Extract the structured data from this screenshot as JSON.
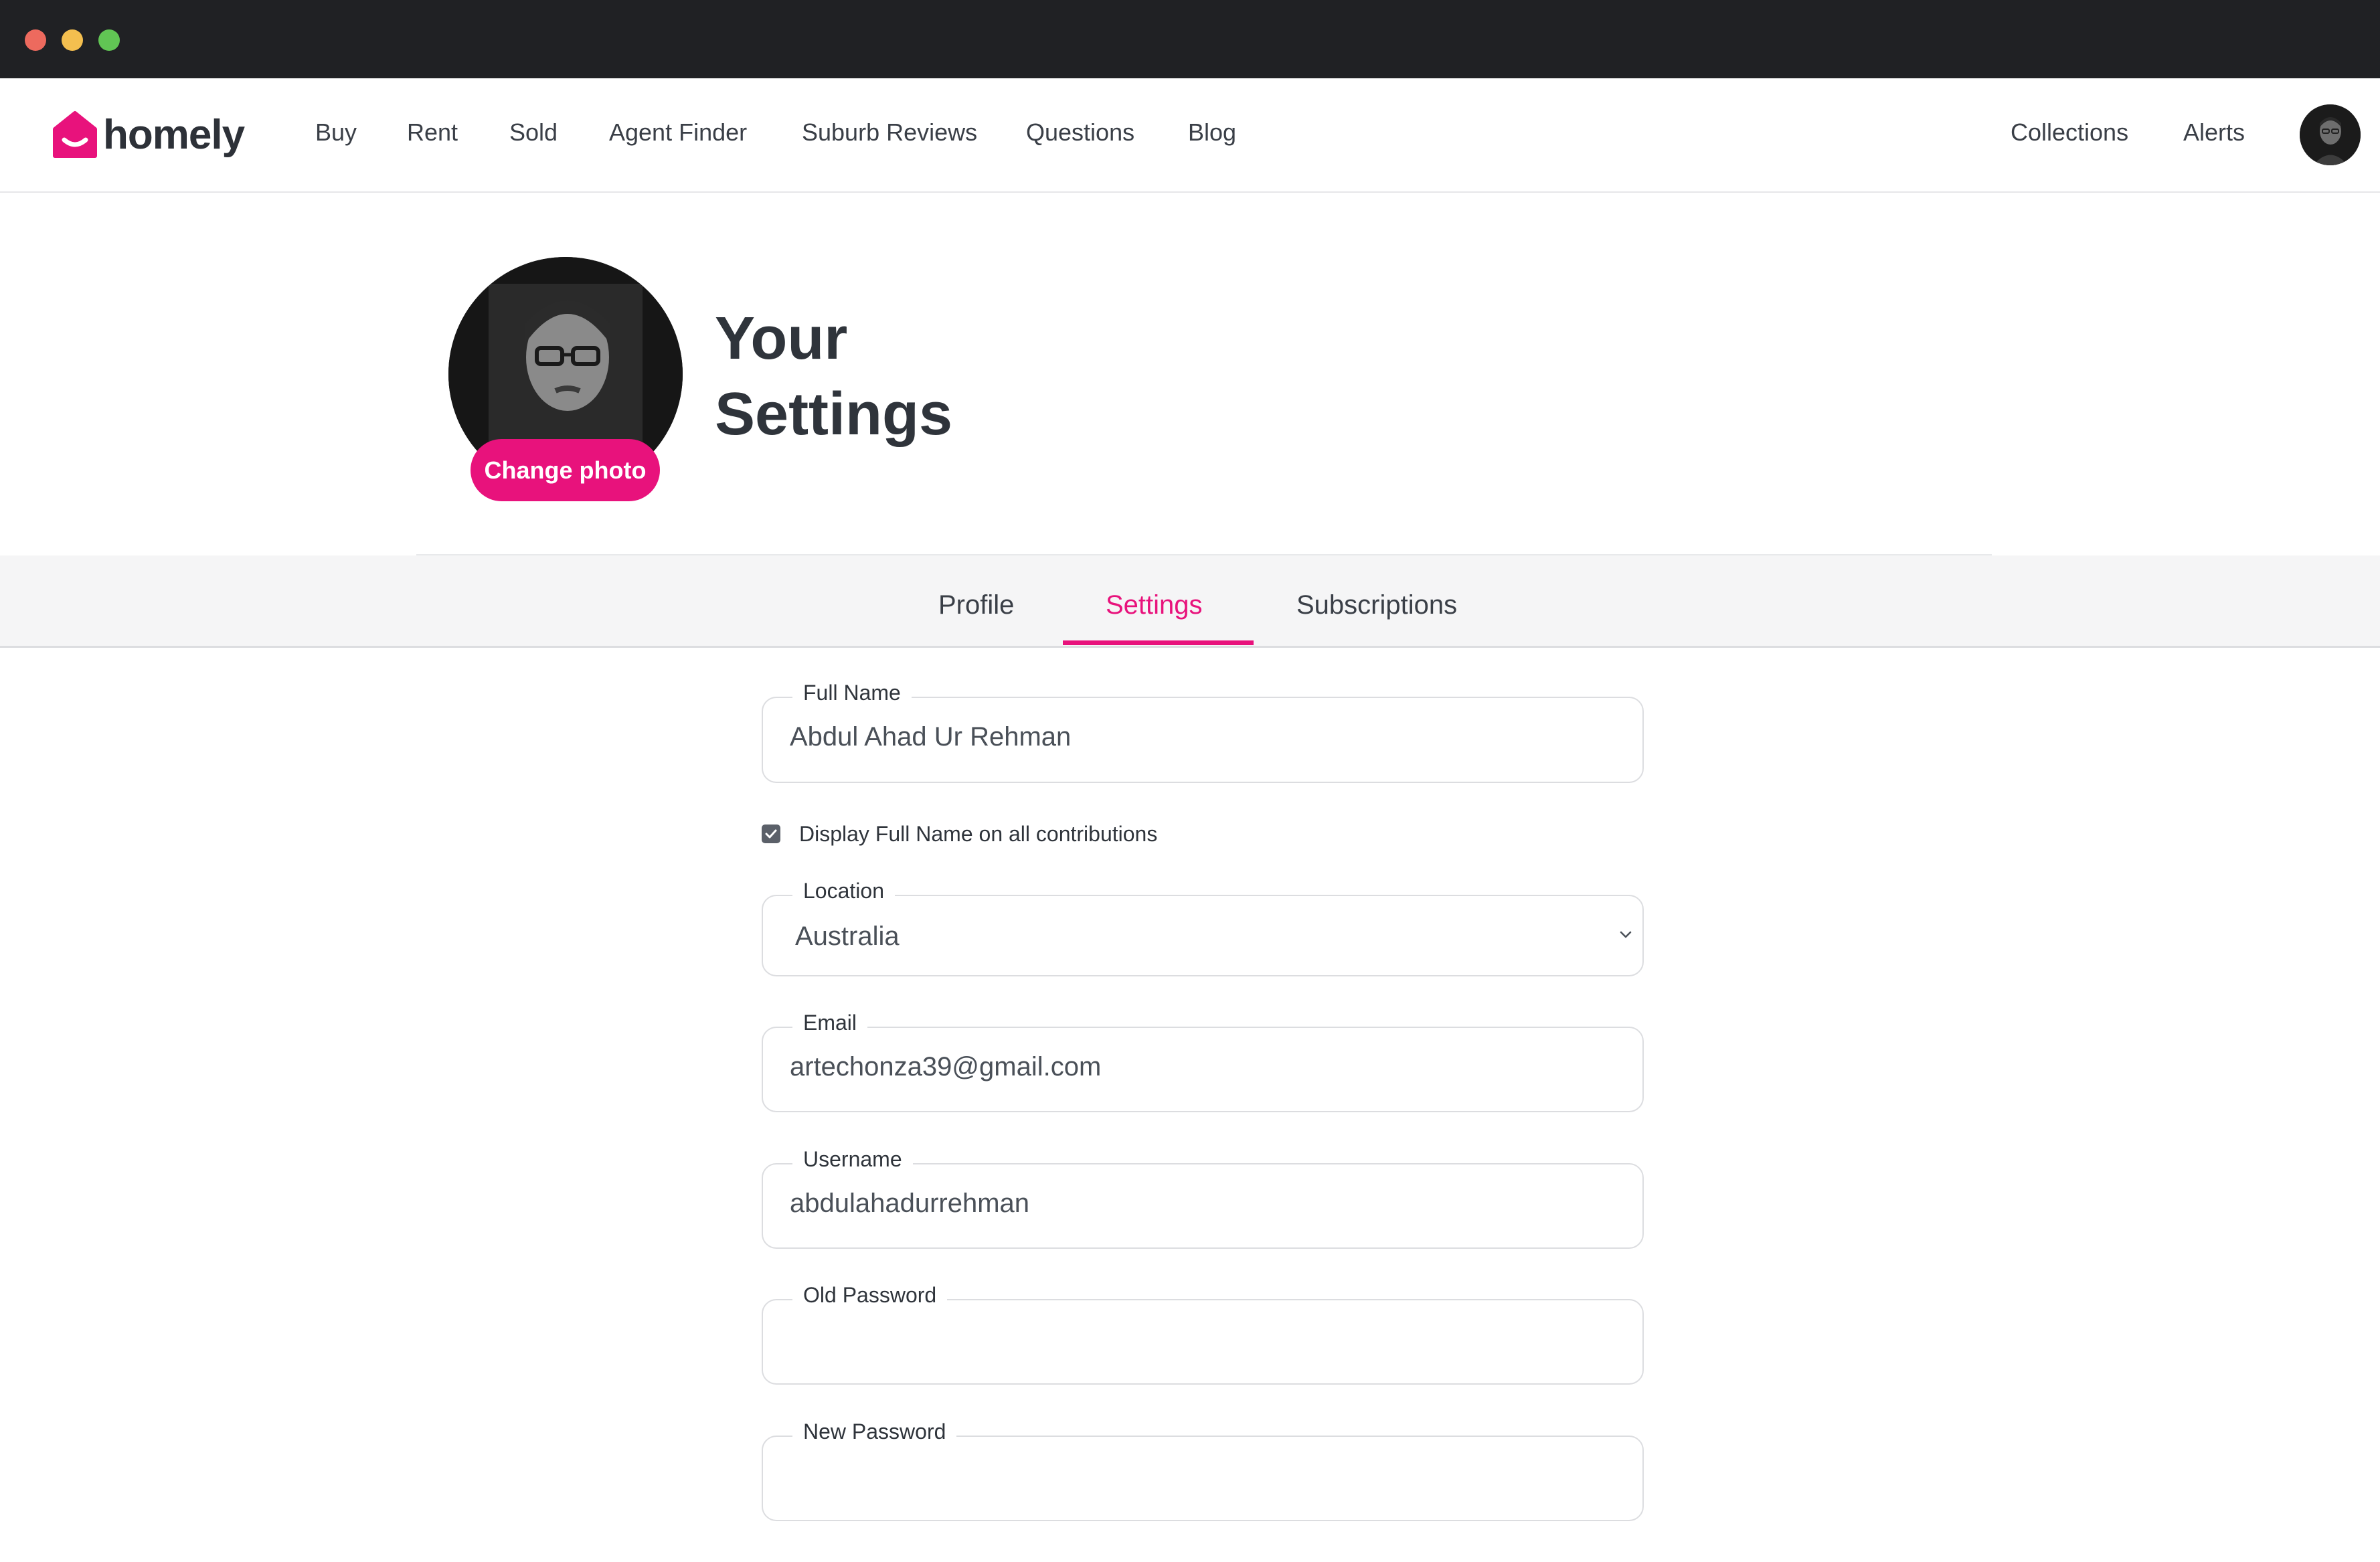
{
  "brand": {
    "name": "homely",
    "accent": "#e8127c"
  },
  "nav": {
    "items": [
      "Buy",
      "Rent",
      "Sold",
      "Agent Finder",
      "Suburb Reviews",
      "Questions",
      "Blog"
    ],
    "right": [
      "Collections",
      "Alerts"
    ]
  },
  "profile": {
    "change_photo_label": "Change photo",
    "title_line1": "Your",
    "title_line2": "Settings"
  },
  "tabs": [
    {
      "label": "Profile",
      "active": false
    },
    {
      "label": "Settings",
      "active": true
    },
    {
      "label": "Subscriptions",
      "active": false
    }
  ],
  "form": {
    "full_name": {
      "label": "Full Name",
      "value": "Abdul Ahad Ur Rehman"
    },
    "display_full_name": {
      "label": "Display Full Name on all contributions",
      "checked": true
    },
    "location": {
      "label": "Location",
      "value": "Australia"
    },
    "email": {
      "label": "Email",
      "value": "artechonza39@gmail.com"
    },
    "username": {
      "label": "Username",
      "value": "abdulahadurrehman"
    },
    "old_password": {
      "label": "Old Password",
      "value": ""
    },
    "new_password": {
      "label": "New Password",
      "value": ""
    }
  }
}
